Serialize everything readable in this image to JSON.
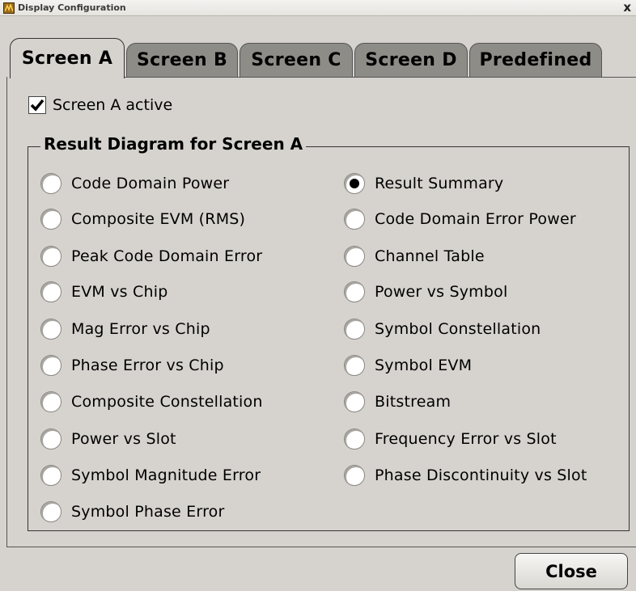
{
  "window": {
    "title": "Display Configuration",
    "close_glyph": "x"
  },
  "tabs": [
    {
      "label": "Screen A",
      "active": true
    },
    {
      "label": "Screen B"
    },
    {
      "label": "Screen C"
    },
    {
      "label": "Screen D"
    },
    {
      "label": "Predefined"
    }
  ],
  "screen_active": {
    "label": "Screen A active",
    "checked": true
  },
  "group_title": "Result Diagram for Screen A",
  "left_options": [
    {
      "label": "Code Domain Power"
    },
    {
      "label": "Composite EVM (RMS)"
    },
    {
      "label": "Peak Code Domain Error"
    },
    {
      "label": "EVM vs Chip"
    },
    {
      "label": "Mag Error vs Chip"
    },
    {
      "label": "Phase Error vs Chip"
    },
    {
      "label": "Composite Constellation"
    },
    {
      "label": "Power vs Slot"
    },
    {
      "label": "Symbol Magnitude Error"
    },
    {
      "label": "Symbol Phase Error"
    }
  ],
  "right_options": [
    {
      "label": "Result Summary",
      "selected": true
    },
    {
      "label": "Code Domain Error Power"
    },
    {
      "label": "Channel Table"
    },
    {
      "label": "Power vs Symbol"
    },
    {
      "label": "Symbol Constellation"
    },
    {
      "label": "Symbol EVM"
    },
    {
      "label": "Bitstream"
    },
    {
      "label": "Frequency Error vs Slot"
    },
    {
      "label": "Phase Discontinuity vs Slot"
    }
  ],
  "close_label": "Close"
}
